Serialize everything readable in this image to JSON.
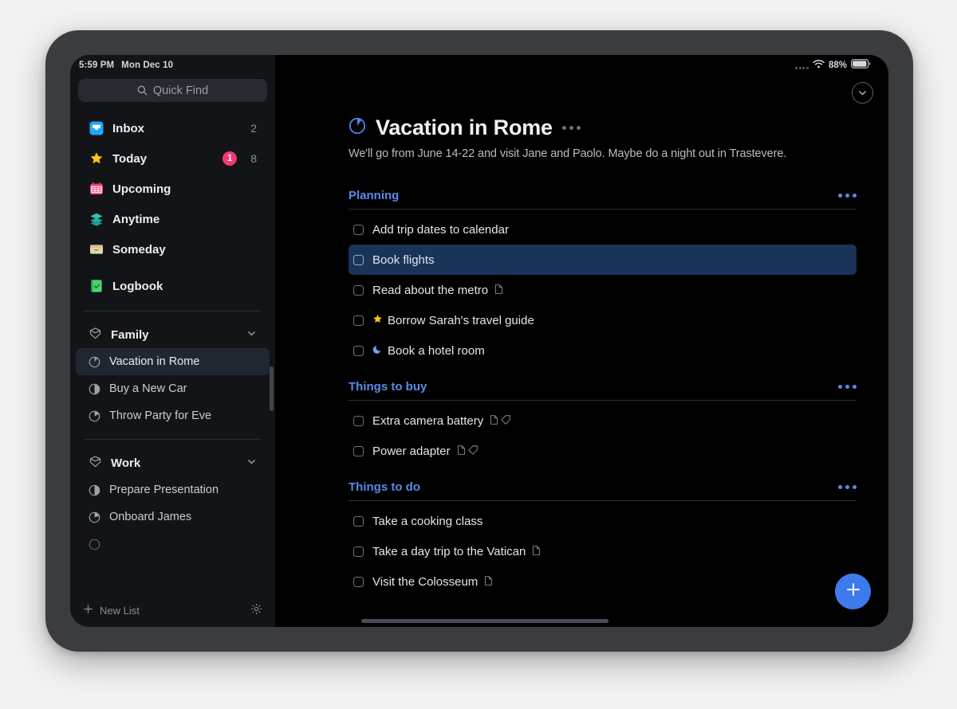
{
  "status_bar": {
    "time": "5:59 PM",
    "date": "Mon Dec 10",
    "battery_percent": "88%",
    "wifi_icon": "wifi-icon",
    "signal_icon": "signal-dots-icon",
    "battery_icon": "battery-icon"
  },
  "sidebar": {
    "quick_find": {
      "placeholder": "Quick Find",
      "icon": "search-icon"
    },
    "nav_items": [
      {
        "label": "Inbox",
        "icon": "inbox-icon",
        "count": "2",
        "badge": ""
      },
      {
        "label": "Today",
        "icon": "star-icon",
        "count": "8",
        "badge": "1"
      },
      {
        "label": "Upcoming",
        "icon": "calendar-icon",
        "count": "",
        "badge": ""
      },
      {
        "label": "Anytime",
        "icon": "layers-icon",
        "count": "",
        "badge": ""
      },
      {
        "label": "Someday",
        "icon": "box-icon",
        "count": "",
        "badge": ""
      },
      {
        "label": "Logbook",
        "icon": "logbook-icon",
        "count": "",
        "badge": ""
      }
    ],
    "groups": [
      {
        "label": "Family",
        "icon": "area-icon",
        "chevron": "chevron-down-icon",
        "projects": [
          {
            "label": "Vacation in Rome",
            "progress": 0.12,
            "selected": true
          },
          {
            "label": "Buy a New Car",
            "progress": 0.5,
            "selected": false
          },
          {
            "label": "Throw Party for Eve",
            "progress": 0.3,
            "selected": false
          }
        ]
      },
      {
        "label": "Work",
        "icon": "area-icon",
        "chevron": "chevron-down-icon",
        "projects": [
          {
            "label": "Prepare Presentation",
            "progress": 0.5,
            "selected": false
          },
          {
            "label": "Onboard James",
            "progress": 0.35,
            "selected": false
          }
        ]
      }
    ],
    "bottom": {
      "new_list_label": "New List",
      "new_list_icon": "plus-icon",
      "settings_icon": "gear-icon"
    }
  },
  "main": {
    "collapse_icon": "chevron-down-circle-icon",
    "project": {
      "title": "Vacation in Rome",
      "progress_icon": "pie-progress-icon",
      "progress": 0.12,
      "menu_icon": "more-dots-icon",
      "note": "We'll go from June 14-22 and visit Jane and Paolo. Maybe do a night out in Trastevere."
    },
    "sections": [
      {
        "title": "Planning",
        "menu_icon": "more-dots-icon",
        "todos": [
          {
            "text": "Add trip dates to calendar",
            "selected": false,
            "marker": "",
            "icons": []
          },
          {
            "text": "Book flights",
            "selected": true,
            "marker": "",
            "icons": []
          },
          {
            "text": "Read about the metro",
            "selected": false,
            "marker": "",
            "icons": [
              "note-icon"
            ]
          },
          {
            "text": "Borrow Sarah's travel guide",
            "selected": false,
            "marker": "star-icon",
            "icons": []
          },
          {
            "text": "Book a hotel room",
            "selected": false,
            "marker": "moon-icon",
            "icons": []
          }
        ]
      },
      {
        "title": "Things to buy",
        "menu_icon": "more-dots-icon",
        "todos": [
          {
            "text": "Extra camera battery",
            "selected": false,
            "marker": "",
            "icons": [
              "note-icon",
              "tag-icon"
            ]
          },
          {
            "text": "Power adapter",
            "selected": false,
            "marker": "",
            "icons": [
              "note-icon",
              "tag-icon"
            ]
          }
        ]
      },
      {
        "title": "Things to do",
        "menu_icon": "more-dots-icon",
        "todos": [
          {
            "text": "Take a cooking class",
            "selected": false,
            "marker": "",
            "icons": []
          },
          {
            "text": "Take a day trip to the Vatican",
            "selected": false,
            "marker": "",
            "icons": [
              "note-icon"
            ]
          },
          {
            "text": "Visit the Colosseum",
            "selected": false,
            "marker": "",
            "icons": [
              "note-icon"
            ]
          }
        ]
      }
    ],
    "add_button": {
      "icon": "plus-icon"
    }
  },
  "colors": {
    "accent_blue": "#5a8ae8",
    "fab_blue": "#3d7bed",
    "selection_blue": "#1a3359",
    "badge_pink": "#f6376f",
    "star_yellow": "#f5c518",
    "sidebar_bg": "#131417",
    "main_bg": "#000000"
  }
}
